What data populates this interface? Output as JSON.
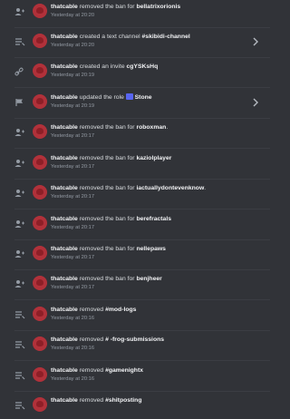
{
  "entries": [
    {
      "icon": "member-icon",
      "actor": "thatcable",
      "pre": " removed the ban for ",
      "target": "bellatrixorionis",
      "post": "",
      "time": "Yesterday at 20:20",
      "chevron": false
    },
    {
      "icon": "channel-icon",
      "actor": "thatcable",
      "pre": " created a text channel ",
      "target": "#skibidi-channel",
      "post": "",
      "time": "Yesterday at 20:20",
      "chevron": true
    },
    {
      "icon": "invite-icon",
      "actor": "thatcable",
      "pre": " created an invite ",
      "target": "cgYSKsHq",
      "post": "",
      "time": "Yesterday at 20:19",
      "chevron": false
    },
    {
      "icon": "role-icon",
      "actor": "thatcable",
      "pre": " updated the role ",
      "target": "Stone",
      "post": "",
      "time": "Yesterday at 20:19",
      "chevron": true
    },
    {
      "icon": "member-icon",
      "actor": "thatcable",
      "pre": " removed the ban for ",
      "target": "roboxman",
      "post": ".",
      "time": "Yesterday at 20:17",
      "chevron": false
    },
    {
      "icon": "member-icon",
      "actor": "thatcable",
      "pre": " removed the ban for ",
      "target": "kaziolplayer",
      "post": "",
      "time": "Yesterday at 20:17",
      "chevron": false
    },
    {
      "icon": "member-icon",
      "actor": "thatcable",
      "pre": " removed the ban for ",
      "target": "iactuallydontevenknow",
      "post": ".",
      "time": "Yesterday at 20:17",
      "chevron": false
    },
    {
      "icon": "member-icon",
      "actor": "thatcable",
      "pre": " removed the ban for ",
      "target": "berefractals",
      "post": "",
      "time": "Yesterday at 20:17",
      "chevron": false
    },
    {
      "icon": "member-icon",
      "actor": "thatcable",
      "pre": " removed the ban for ",
      "target": "nellepaws",
      "post": "",
      "time": "Yesterday at 20:17",
      "chevron": false
    },
    {
      "icon": "member-icon",
      "actor": "thatcable",
      "pre": " removed the ban for ",
      "target": "benjheer",
      "post": "",
      "time": "Yesterday at 20:17",
      "chevron": false
    },
    {
      "icon": "channel-icon",
      "actor": "thatcable",
      "pre": " removed ",
      "target": "#mod-logs",
      "post": "",
      "time": "Yesterday at 20:16",
      "chevron": false
    },
    {
      "icon": "channel-icon",
      "actor": "thatcable",
      "pre": " removed ",
      "target": "# -frog-submissions",
      "post": "",
      "time": "Yesterday at 20:16",
      "chevron": false
    },
    {
      "icon": "channel-icon",
      "actor": "thatcable",
      "pre": " removed ",
      "target": "#gamenightx",
      "post": "",
      "time": "Yesterday at 20:16",
      "chevron": false
    },
    {
      "icon": "channel-icon",
      "actor": "thatcable",
      "pre": " removed ",
      "target": "#shitposting",
      "post": "",
      "time": "",
      "chevron": false
    }
  ],
  "colors": {
    "background": "#313338",
    "avatar": "#b1313a",
    "text": "#dbdee1",
    "muted": "#949ba4"
  }
}
